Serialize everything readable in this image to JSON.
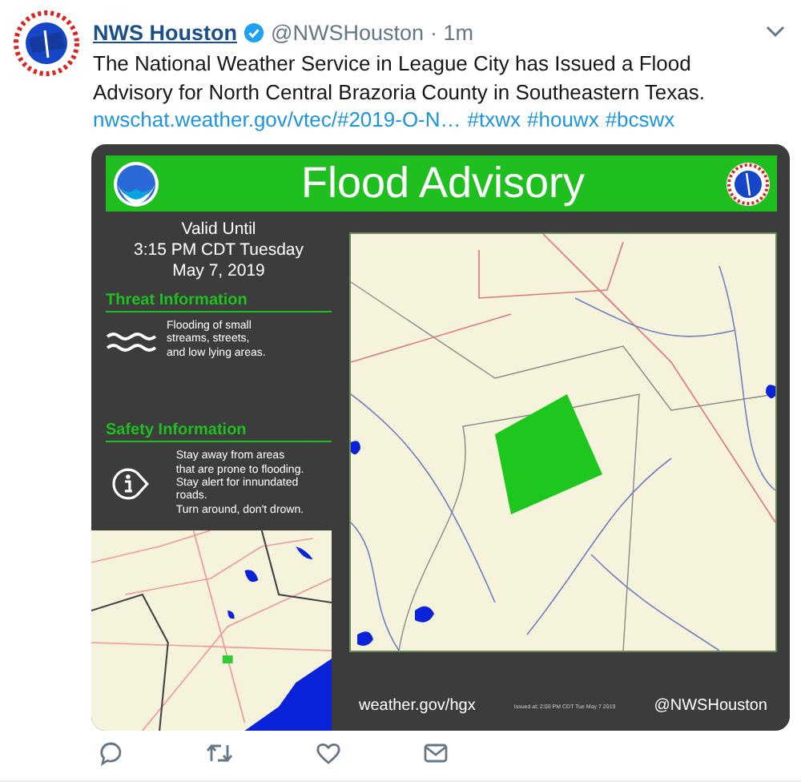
{
  "author": {
    "name": "NWS Houston",
    "verified": true,
    "handle": "@NWSHouston",
    "time": "· 1m"
  },
  "tweet": {
    "text": "The National Weather Service in League City has Issued a Flood Advisory for North Central Brazoria County in Southeastern Texas.",
    "link": "nwschat.weather.gov/vtec/#2019-O-N…",
    "hashtags": [
      "#txwx",
      "#houwx",
      "#bcswx"
    ]
  },
  "graphic": {
    "title": "Flood Advisory",
    "valid": [
      "Valid Until",
      "3:15 PM CDT Tuesday",
      "May 7, 2019"
    ],
    "sections": [
      {
        "heading": "Threat Information",
        "kind": "waves",
        "lines": [
          "Flooding of small",
          "streams, streets,",
          "and low lying areas."
        ]
      },
      {
        "heading": "Safety Information",
        "kind": "info",
        "lines": [
          "Stay away from areas",
          "that are prone to flooding.",
          "Stay alert for innundated roads.",
          "Turn around, don't drown."
        ]
      }
    ],
    "website": "weather.gov/hgx",
    "issued": "Issued at: 2:00 PM CDT Tue May 7 2019",
    "account": "@NWSHouston"
  },
  "actions": [
    {
      "kind": "reply"
    },
    {
      "kind": "retweet"
    },
    {
      "kind": "like"
    },
    {
      "kind": "message"
    }
  ]
}
